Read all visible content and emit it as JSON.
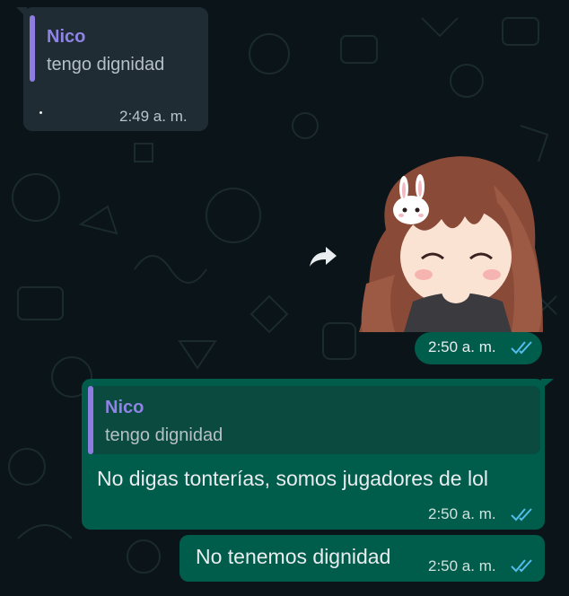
{
  "messages": [
    {
      "direction": "incoming",
      "quote": {
        "author": "Nico",
        "text": "tengo dignidad"
      },
      "time": "2:49 a. m."
    },
    {
      "direction": "outgoing",
      "type": "sticker",
      "sticker_icon": "anime-girl-bunny-sticker",
      "time": "2:50 a. m.",
      "status": "read"
    },
    {
      "direction": "outgoing",
      "quote": {
        "author": "Nico",
        "text": "tengo dignidad"
      },
      "text": "No digas tonterías, somos jugadores de lol",
      "time": "2:50 a. m.",
      "status": "read"
    },
    {
      "direction": "outgoing",
      "text": "No tenemos dignidad",
      "time": "2:50 a. m.",
      "status": "read"
    }
  ],
  "colors": {
    "background": "#0b1418",
    "incoming_bubble": "#202c33",
    "outgoing_bubble": "#005c4b",
    "quote_author": "#8f84e6",
    "read_ticks": "#53bdeb"
  },
  "icons": {
    "forward": "forward-arrow-icon",
    "read_receipt": "double-check-icon"
  }
}
